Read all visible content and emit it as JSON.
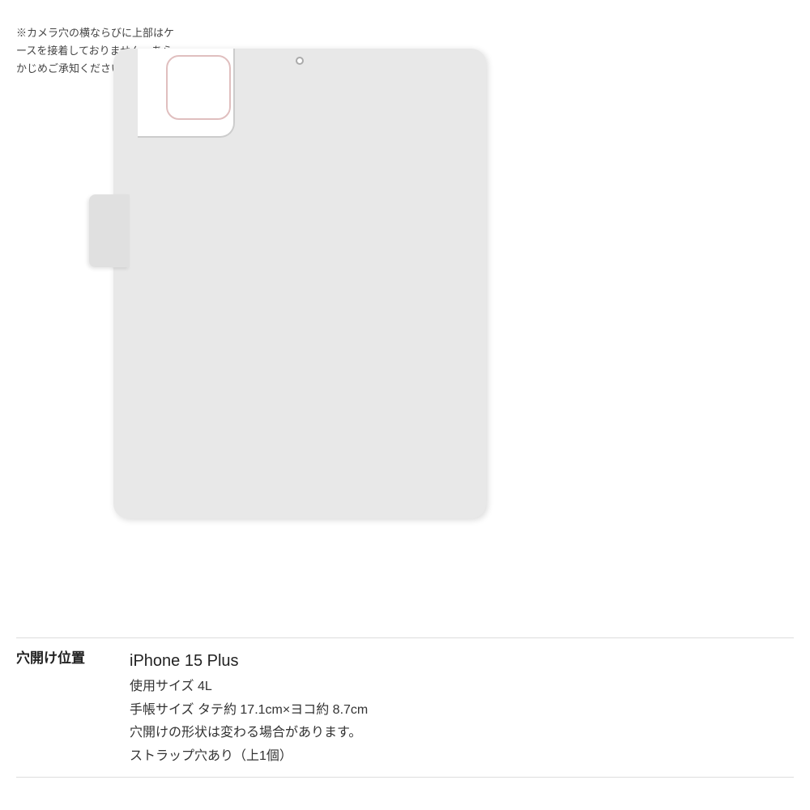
{
  "note": {
    "text": "※カメラ穴の横ならびに上部はケースを接着しておりません。あらかじめご承知ください。"
  },
  "label": {
    "hole_position": "穴開け位置"
  },
  "details": {
    "device_name": "iPhone 15 Plus",
    "size_label": "使用サイズ 4L",
    "notebook_size": "手帳サイズ タテ約 17.1cm×ヨコ約 8.7cm",
    "shape_note": "穴開けの形状は変わる場合があります。",
    "strap_note": "ストラップ穴あり（上1個）"
  }
}
